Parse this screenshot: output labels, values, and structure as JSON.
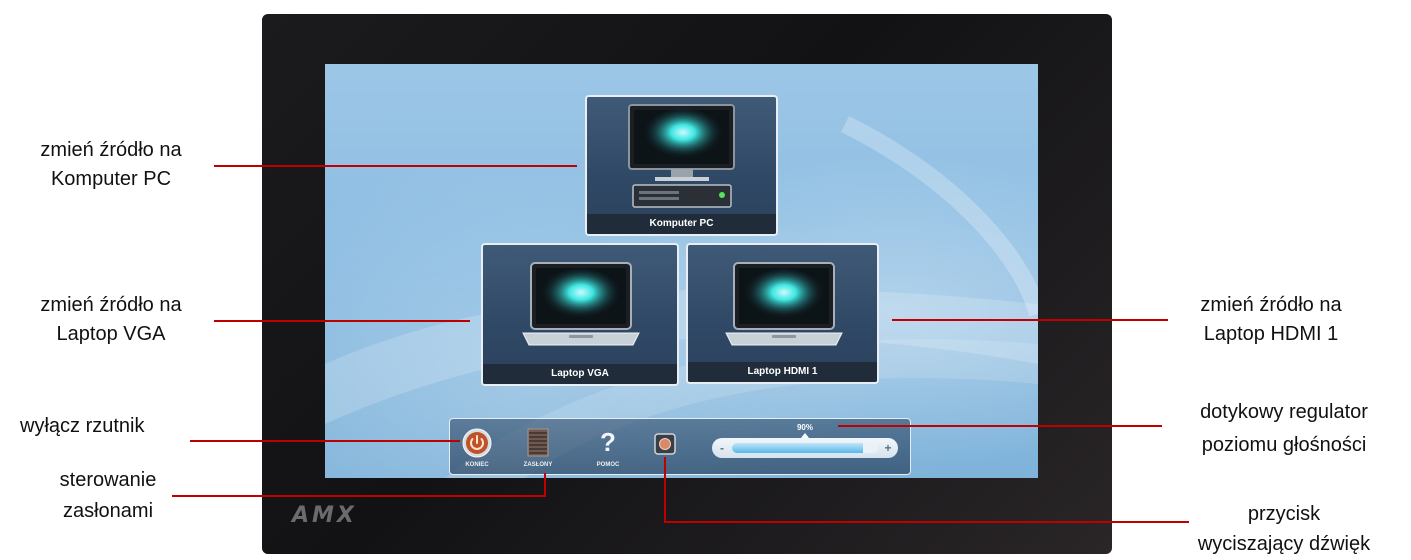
{
  "device": {
    "brand": "AMX"
  },
  "sources": [
    {
      "id": "pc",
      "label": "Komputer PC"
    },
    {
      "id": "vga",
      "label": "Laptop VGA"
    },
    {
      "id": "hdmi",
      "label": "Laptop HDMI 1"
    }
  ],
  "controls": {
    "power_label": "KONIEC",
    "blinds_label": "ZASŁONY",
    "help_label": "POMOC",
    "help_glyph": "?",
    "volume": {
      "percent_label": "90%",
      "level": 0.9,
      "minus": "-",
      "plus": "+"
    }
  },
  "annotations": {
    "pc": {
      "line1": "zmień źródło na",
      "line2": "Komputer PC"
    },
    "vga": {
      "line1": "zmień źródło na",
      "line2": "Laptop VGA"
    },
    "hdmi": {
      "line1": "zmień źródło na",
      "line2": "Laptop HDMI 1"
    },
    "power": {
      "line1": "wyłącz rzutnik"
    },
    "blinds": {
      "line1": "sterowanie",
      "line2": "zasłonami"
    },
    "volume": {
      "line1": "dotykowy regulator",
      "line2": "poziomu głośności"
    },
    "mute": {
      "line1": "przycisk",
      "line2": "wyciszający dźwięk"
    }
  },
  "colors": {
    "leader_line": "#c00000",
    "accent_glow": "#3ee6e0",
    "power_button": "#c0522a"
  }
}
